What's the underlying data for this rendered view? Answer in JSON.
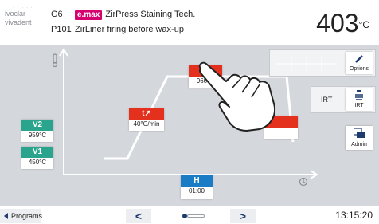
{
  "header": {
    "logo_top": "ivoclar",
    "logo_bottom": "vivadent",
    "program_group": "G6",
    "brand": "e.max",
    "title": "ZirPress Staining Tech.",
    "program_number": "P101",
    "program_name": "ZirLiner firing before wax-up",
    "temperature": "403",
    "temperature_unit": "°C"
  },
  "chart": {
    "params": {
      "v2": {
        "label": "V2",
        "value": "959°C"
      },
      "v1": {
        "label": "V1",
        "value": "450°C"
      },
      "t_rate": {
        "label": "t↗",
        "value": "40°C/min"
      },
      "T": {
        "label": "T",
        "value": "960°C"
      },
      "H": {
        "label": "H",
        "value": "01:00"
      }
    }
  },
  "side": {
    "options_label": "Options",
    "irt_text": "IRT",
    "irt_label": "IRT",
    "admin_label": "Admin"
  },
  "footer": {
    "programs_label": "Programs",
    "prev": "<",
    "next": ">",
    "time": "13:15:20"
  },
  "colors": {
    "brand": "#d6006e",
    "green": "#2aa48c",
    "red": "#e3311d",
    "blue": "#1a7cc4",
    "nav": "#1e3a6e"
  }
}
